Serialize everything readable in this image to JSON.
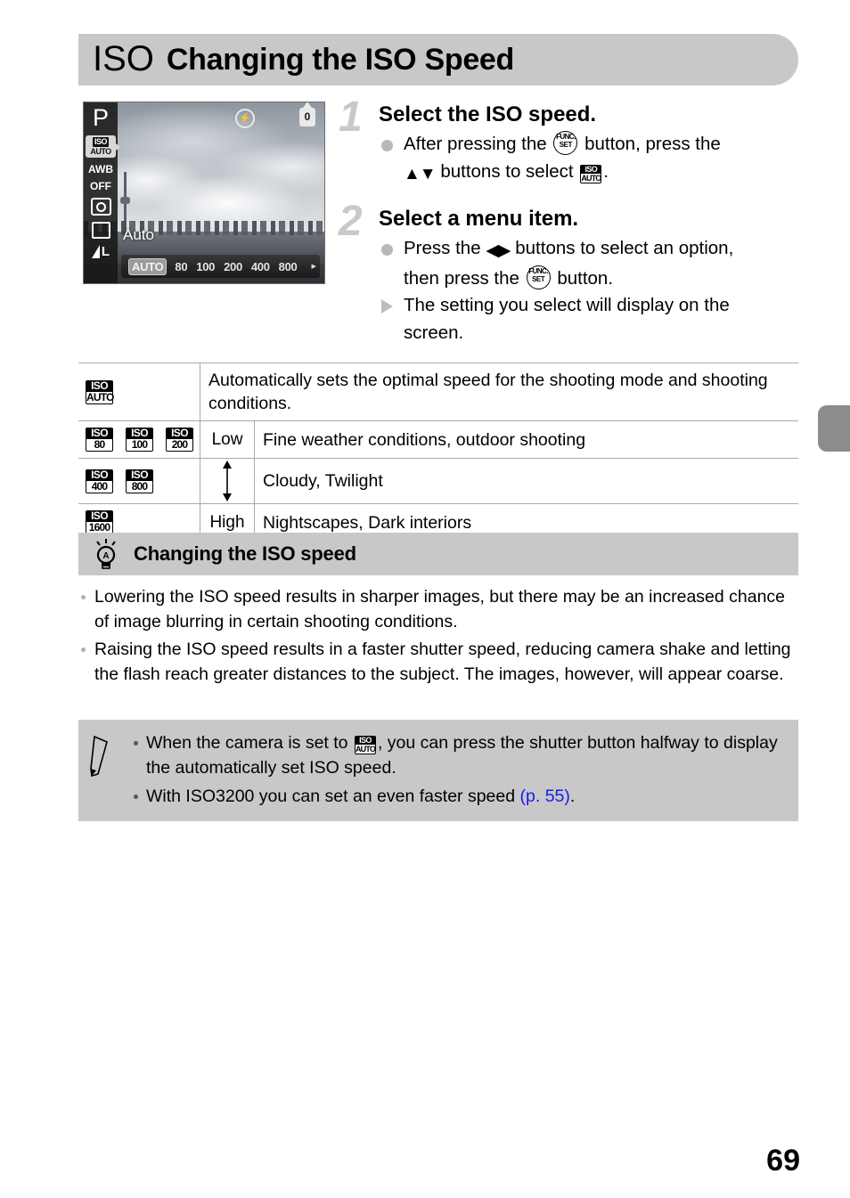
{
  "header": {
    "iso_logo": "ISO",
    "title": "Changing the ISO Speed"
  },
  "camera_screen": {
    "mode_label": "P",
    "iso_indicator_top": "ISO",
    "iso_indicator_bottom": "AUTO",
    "white_balance": "AWB",
    "flash_mode": "OFF",
    "quality_label": "L",
    "flash_off_icon": "flash-off-icon",
    "battery_icon_label": "0",
    "selected_label": "Auto",
    "iso_options": [
      "AUTO",
      "80",
      "100",
      "200",
      "400",
      "800"
    ],
    "selected_option": "AUTO",
    "more_arrow": "▸"
  },
  "steps": [
    {
      "number": "1",
      "heading": "Select the ISO speed.",
      "lines": [
        {
          "bullet": "dot",
          "parts": [
            {
              "type": "text",
              "value": "After pressing the "
            },
            {
              "type": "icon",
              "value": "func-set-button-icon"
            },
            {
              "type": "text",
              "value": " button, press the"
            }
          ]
        },
        {
          "bullet": "none",
          "parts": [
            {
              "type": "icon",
              "value": "up-down-buttons-icon"
            },
            {
              "type": "text",
              "value": " buttons to select "
            },
            {
              "type": "icon",
              "value": "iso-auto-icon"
            },
            {
              "type": "text",
              "value": "."
            }
          ]
        }
      ]
    },
    {
      "number": "2",
      "heading": "Select a menu item.",
      "lines": [
        {
          "bullet": "dot",
          "parts": [
            {
              "type": "text",
              "value": "Press the "
            },
            {
              "type": "icon",
              "value": "left-right-buttons-icon"
            },
            {
              "type": "text",
              "value": " buttons to select an option,"
            }
          ]
        },
        {
          "bullet": "none",
          "parts": [
            {
              "type": "text",
              "value": "then press the "
            },
            {
              "type": "icon",
              "value": "func-set-button-icon"
            },
            {
              "type": "text",
              "value": " button."
            }
          ]
        },
        {
          "bullet": "triangle",
          "parts": [
            {
              "type": "text",
              "value": "The setting you select will display on the"
            }
          ]
        },
        {
          "bullet": "none",
          "parts": [
            {
              "type": "text",
              "value": "screen."
            }
          ]
        }
      ]
    }
  ],
  "step1": {
    "number": "1",
    "heading": "Select the ISO speed.",
    "line1_a": "After pressing the",
    "line1_b": "button, press the",
    "line2_a": "buttons to select",
    "line2_b": "."
  },
  "step2": {
    "number": "2",
    "heading": "Select a menu item.",
    "line1_a": "Press the",
    "line1_b": "buttons to select an option,",
    "line2_a": "then press the",
    "line2_b": "button.",
    "line3": "The setting you select will display on the",
    "line4": "screen."
  },
  "iso_table": {
    "rows": [
      {
        "icons": [
          {
            "top": "ISO",
            "bottom": "AUTO"
          }
        ],
        "level": "",
        "description": "Automatically sets the optimal speed for the shooting mode and shooting conditions."
      },
      {
        "icons": [
          {
            "top": "ISO",
            "bottom": "80"
          },
          {
            "top": "ISO",
            "bottom": "100"
          },
          {
            "top": "ISO",
            "bottom": "200"
          }
        ],
        "level": "Low",
        "description": "Fine weather conditions, outdoor shooting"
      },
      {
        "icons": [
          {
            "top": "ISO",
            "bottom": "400"
          },
          {
            "top": "ISO",
            "bottom": "800"
          }
        ],
        "level": "",
        "description": "Cloudy, Twilight"
      },
      {
        "icons": [
          {
            "top": "ISO",
            "bottom": "1600"
          }
        ],
        "level": "High",
        "description": "Nightscapes, Dark interiors"
      }
    ]
  },
  "tip": {
    "icon": "lightbulb-icon",
    "title": "Changing the ISO speed",
    "items": [
      "Lowering the ISO speed results in sharper images, but there may be an increased chance of image blurring in certain shooting conditions.",
      "Raising the ISO speed results in a faster shutter speed, reducing camera shake and letting the flash reach greater distances to the subject. The images, however, will appear coarse."
    ]
  },
  "note": {
    "icon": "pencil-icon",
    "item1_a": "When the camera is set to",
    "item1_b": ", you can press the shutter button halfway to display the automatically set ISO speed.",
    "item2_a": "With ISO3200 you can set an even faster speed",
    "item2_link": "(p. 55)",
    "item2_b": "."
  },
  "page_number": "69",
  "colors": {
    "header_gray": "#c8c8c8",
    "edge_tab_gray": "#8c8c8c",
    "link_blue": "#1a1af0",
    "step_number_gray": "#c9c9c9"
  }
}
